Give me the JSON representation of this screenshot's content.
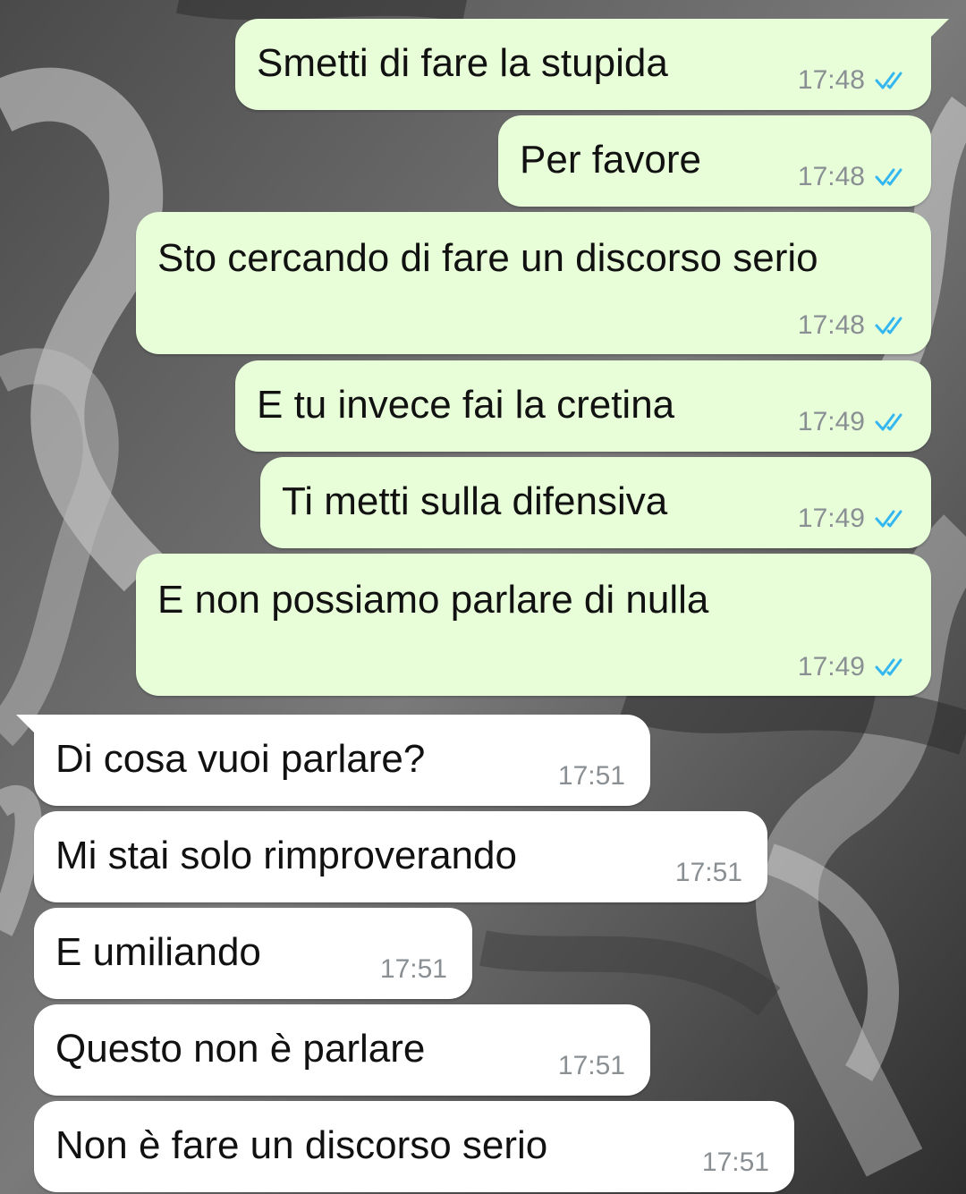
{
  "accent": {
    "read_receipt": "#34b7f1",
    "outgoing_bubble": "#e7fed8",
    "incoming_bubble": "#ffffff"
  },
  "icons": {
    "read_receipt": "double-check-icon"
  },
  "messages_out": [
    {
      "text": "Smetti di fare la stupida",
      "time": "17:48"
    },
    {
      "text": "Per favore",
      "time": "17:48"
    },
    {
      "text": "Sto cercando di fare un discorso serio",
      "time": "17:48"
    },
    {
      "text": "E tu invece fai la cretina",
      "time": "17:49"
    },
    {
      "text": "Ti metti sulla difensiva",
      "time": "17:49"
    },
    {
      "text": "E non possiamo parlare di nulla",
      "time": "17:49"
    }
  ],
  "messages_in": [
    {
      "text": "Di cosa vuoi parlare?",
      "time": "17:51"
    },
    {
      "text": "Mi stai solo rimproverando",
      "time": "17:51"
    },
    {
      "text": "E umiliando",
      "time": "17:51"
    },
    {
      "text": "Questo non è parlare",
      "time": "17:51"
    },
    {
      "text": "Non è fare un discorso serio",
      "time": "17:51"
    }
  ]
}
